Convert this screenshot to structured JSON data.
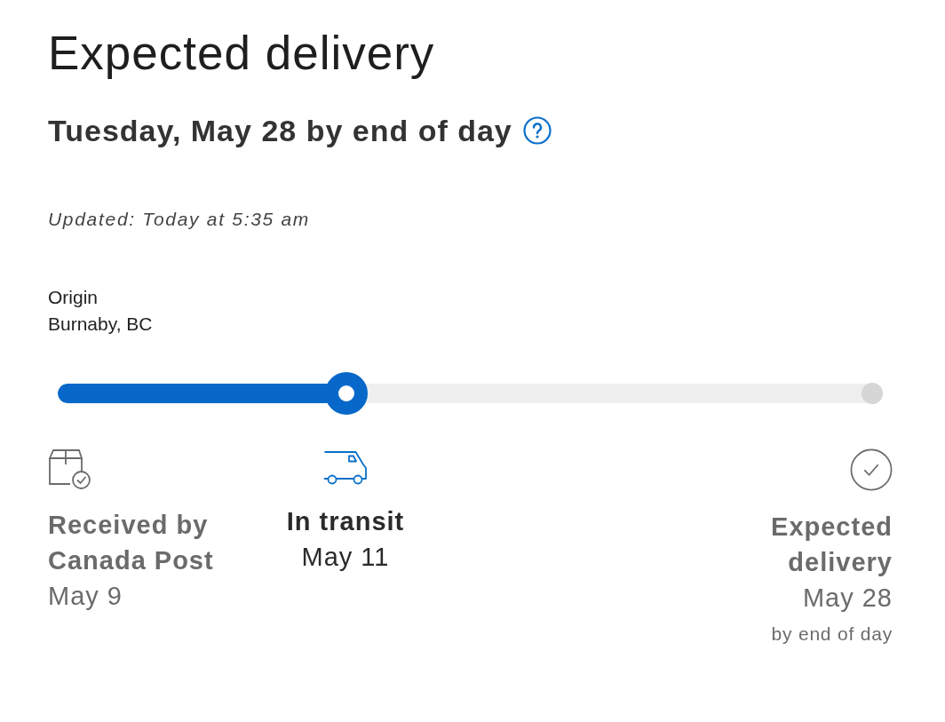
{
  "heading": "Expected delivery",
  "estimate": "Tuesday, May 28 by end of day",
  "updated": "Updated: Today at 5:35 am",
  "origin": {
    "label": "Origin",
    "place": "Burnaby, BC"
  },
  "progress": {
    "level": 0.35
  },
  "steps": [
    {
      "kind": "received",
      "title": "Received by Canada Post",
      "date": "May 9",
      "selected": false
    },
    {
      "kind": "transit",
      "title": "In transit",
      "date": "May 11",
      "selected": true
    },
    {
      "kind": "delivery",
      "title": "Expected delivery",
      "date": "May 28",
      "note": "by end of day",
      "selected": false
    }
  ]
}
